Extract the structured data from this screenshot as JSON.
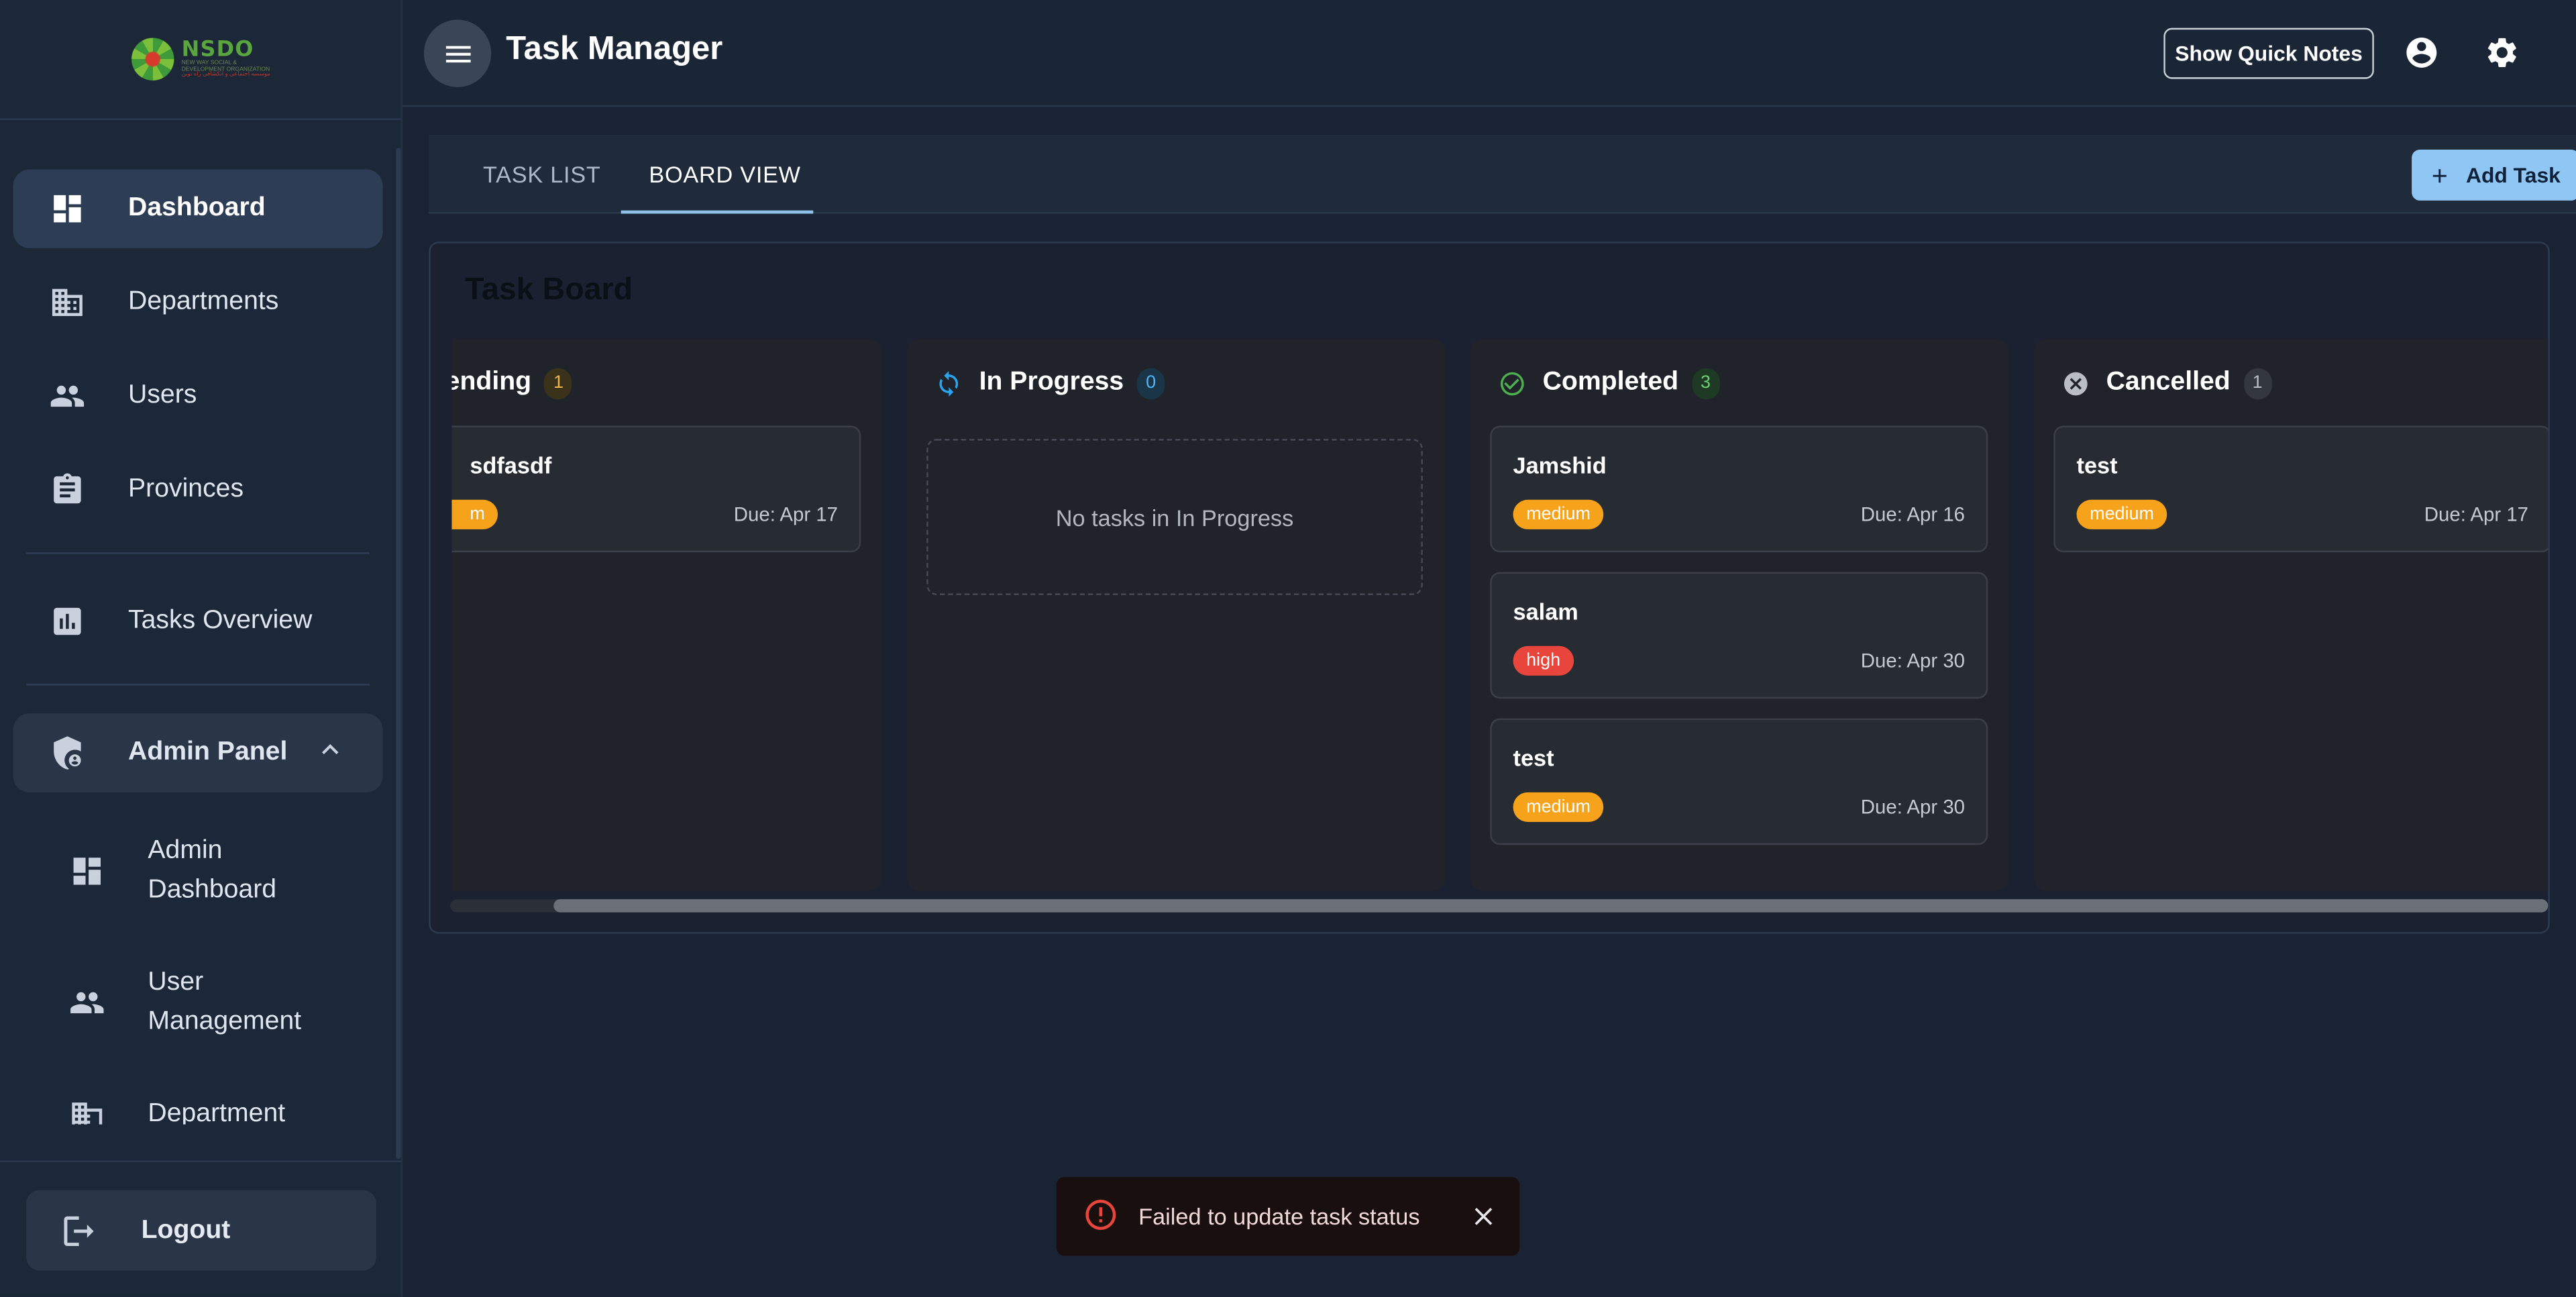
{
  "logo": {
    "name": "NSDO",
    "subtitle": "NEW WAY SOCIAL & DEVELOPMENT ORGANIZATION",
    "subtitle_local": "موسسه اجتماعی و انکشافی راه نوین"
  },
  "header": {
    "title": "Task Manager",
    "quick_notes_label": "Show Quick Notes",
    "icons": [
      "menu-icon",
      "account-icon",
      "settings-icon"
    ]
  },
  "sidebar": {
    "items": [
      {
        "label": "Dashboard",
        "icon": "dashboard-icon",
        "active": true
      },
      {
        "label": "Departments",
        "icon": "building-icon"
      },
      {
        "label": "Users",
        "icon": "people-icon"
      },
      {
        "label": "Provinces",
        "icon": "clipboard-icon"
      },
      {
        "label": "Tasks Overview",
        "icon": "chart-icon"
      }
    ],
    "admin": {
      "label": "Admin Panel",
      "icon": "admin-shield-icon",
      "expanded": true,
      "items": [
        {
          "label": "Admin Dashboard",
          "icon": "dashboard-icon"
        },
        {
          "label": "User Management",
          "icon": "people-icon"
        },
        {
          "label": "Department",
          "icon": "building-icon"
        }
      ]
    },
    "logout_label": "Logout"
  },
  "tabs": [
    {
      "label": "TASK LIST",
      "active": false
    },
    {
      "label": "BOARD VIEW",
      "active": true
    }
  ],
  "add_task_label": "Add Task",
  "board": {
    "title": "Task Board",
    "columns": [
      {
        "label": "ending",
        "count": "1",
        "icon": "pending-icon",
        "cards": [
          {
            "title": "sdfasdf",
            "priority": "m",
            "due": "Due: Apr 17"
          }
        ]
      },
      {
        "label": "In Progress",
        "count": "0",
        "icon": "sync-icon",
        "empty_text": "No tasks in In Progress",
        "cards": []
      },
      {
        "label": "Completed",
        "count": "3",
        "icon": "check-circle-icon",
        "cards": [
          {
            "title": "Jamshid",
            "priority": "medium",
            "due": "Due: Apr 16"
          },
          {
            "title": "salam",
            "priority": "high",
            "due": "Due: Apr 30"
          },
          {
            "title": "test",
            "priority": "medium",
            "due": "Due: Apr 30"
          }
        ]
      },
      {
        "label": "Cancelled",
        "count": "1",
        "icon": "cancel-circle-icon",
        "cards": [
          {
            "title": "test",
            "priority": "medium",
            "due": "Due: Apr 17"
          }
        ]
      }
    ]
  },
  "toast": {
    "message": "Failed to update task status",
    "severity": "error"
  },
  "colors": {
    "accent": "#90c6f3",
    "medium": "#f7a21b",
    "high": "#e8453c",
    "completed": "#4caf50",
    "progress": "#29a3f0"
  }
}
